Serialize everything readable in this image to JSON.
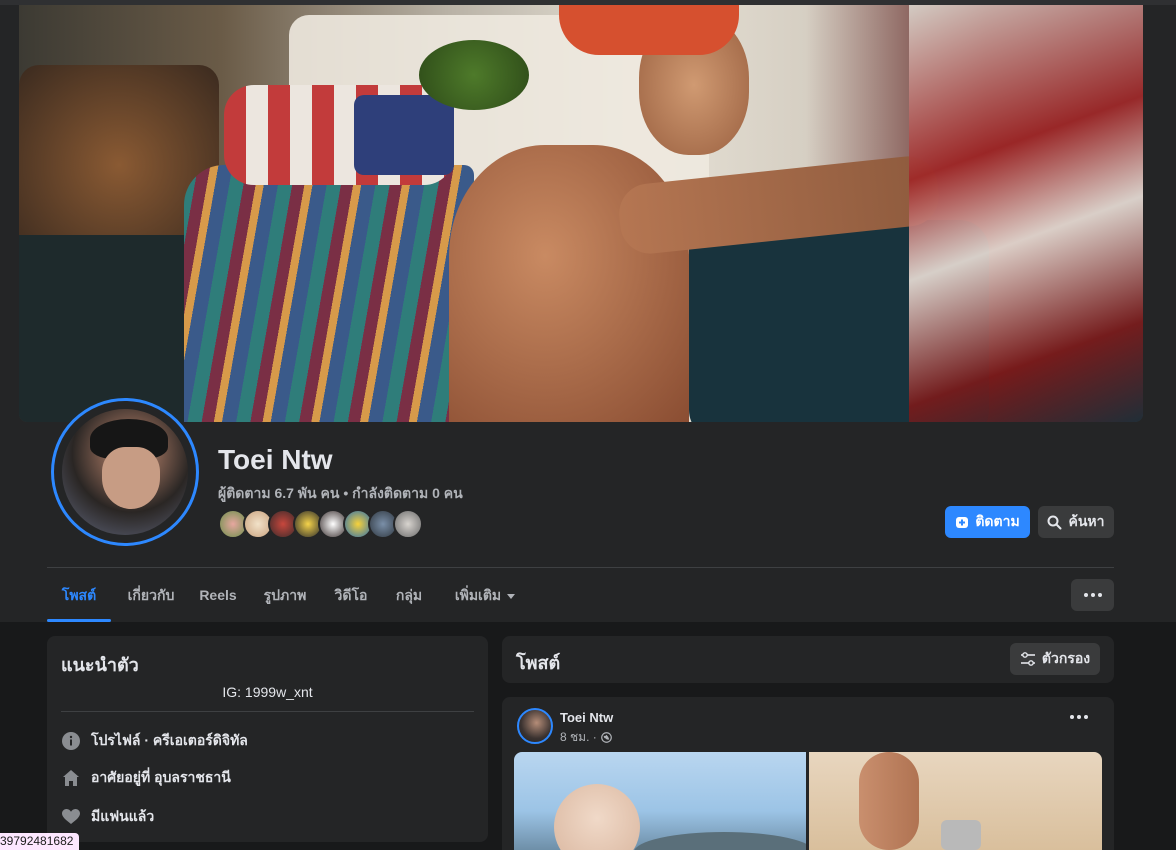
{
  "profile": {
    "name": "Toei Ntw",
    "stats": "ผู้ติดตาม 6.7 พัน คน • กำลังติดตาม 0 คน",
    "follow_label": "ติดตาม",
    "search_label": "ค้นหา"
  },
  "tabs": [
    "โพสต์",
    "เกี่ยวกับ",
    "Reels",
    "รูปภาพ",
    "วิดีโอ",
    "กลุ่ม",
    "เพิ่มเติม"
  ],
  "intro": {
    "title": "แนะนำตัว",
    "bio": "IG: 1999w_xnt",
    "rows": [
      {
        "icon": "info-icon",
        "text": "โปรไฟล์ · ครีเอเตอร์ดิจิทัล"
      },
      {
        "icon": "home-icon",
        "text": "อาศัยอยู่ที่ อุบลราชธานี"
      },
      {
        "icon": "heart-icon",
        "text": "มีแฟนแล้ว"
      }
    ]
  },
  "posts": {
    "title": "โพสต์",
    "filter_label": "ตัวกรอง"
  },
  "post": {
    "author": "Toei Ntw",
    "time": "8 ชม. ·"
  },
  "overlay": {
    "corner_text": "39792481682"
  },
  "colors": {
    "accent": "#2d88ff",
    "background": "#18191a",
    "card": "#242526"
  }
}
